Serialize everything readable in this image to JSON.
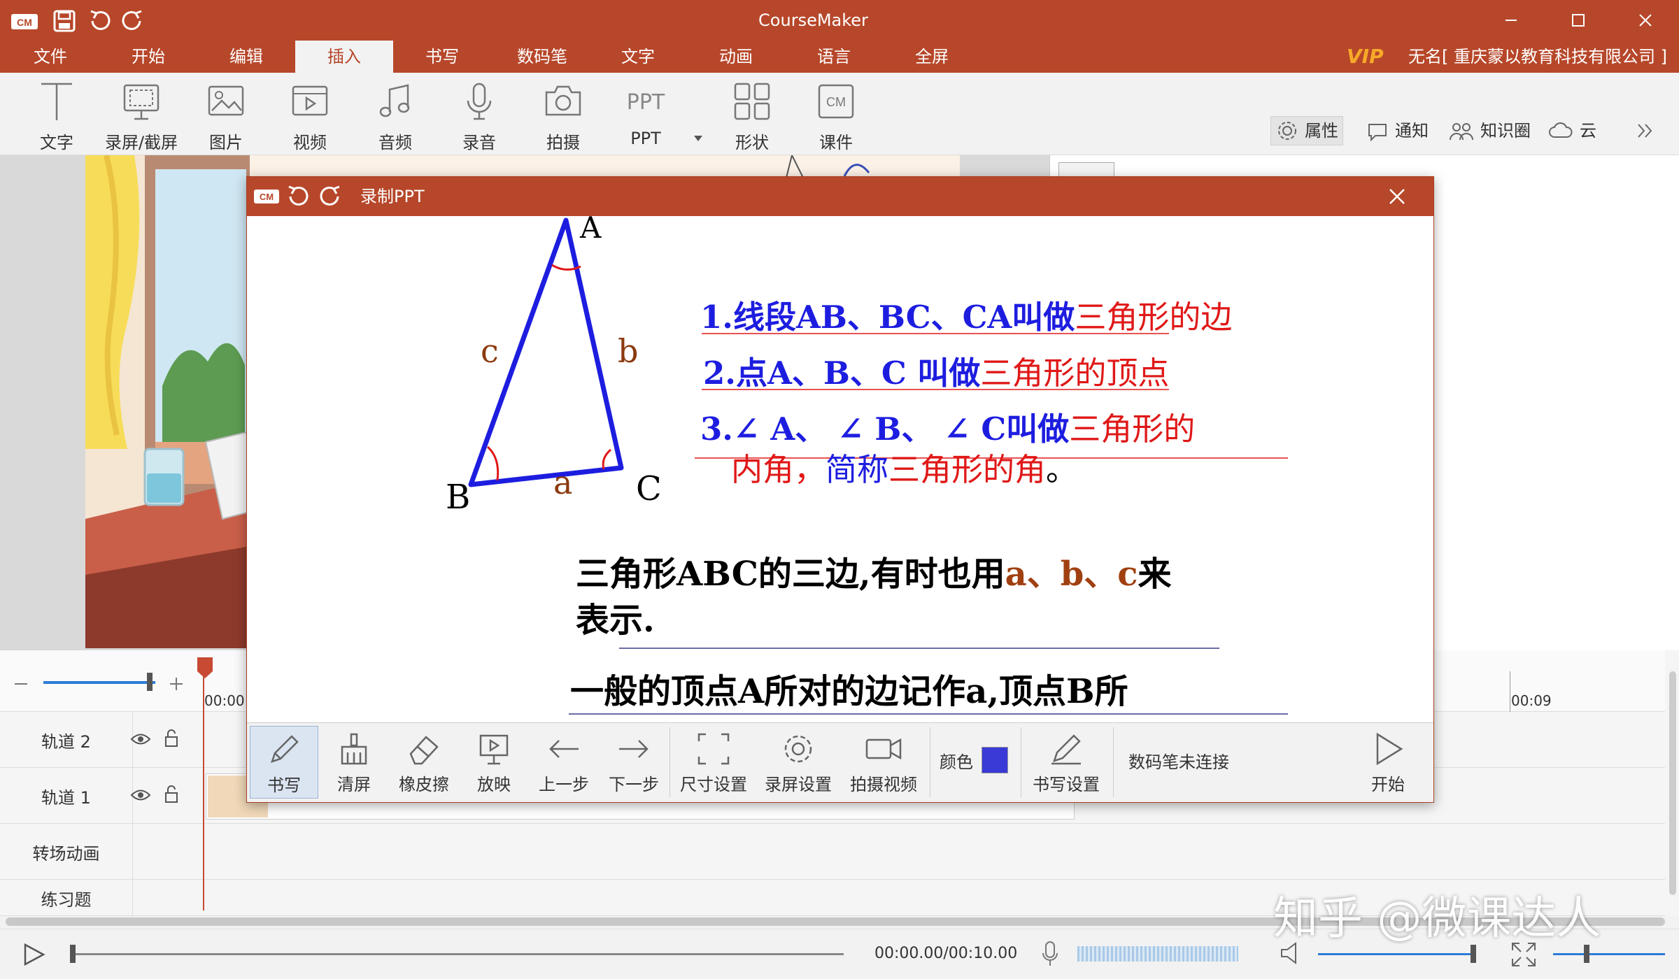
{
  "app": {
    "title": "CourseMaker",
    "logo": "CM",
    "brand_color": "#b7472a"
  },
  "menu": {
    "items": [
      "文件",
      "开始",
      "编辑",
      "插入",
      "书写",
      "数码笔",
      "文字",
      "动画",
      "语言",
      "全屏"
    ],
    "active": "插入",
    "vip": "VIP",
    "user": "无名[ 重庆蒙以教育科技有限公司 ]"
  },
  "ribbon": {
    "tools": [
      {
        "label": "文字",
        "icon": "text-icon"
      },
      {
        "label": "录屏/截屏",
        "icon": "screen-record-icon"
      },
      {
        "label": "图片",
        "icon": "image-icon"
      },
      {
        "label": "视频",
        "icon": "video-icon"
      },
      {
        "label": "音频",
        "icon": "music-icon"
      },
      {
        "label": "录音",
        "icon": "microphone-icon"
      },
      {
        "label": "拍摄",
        "icon": "camera-icon"
      },
      {
        "label": "PPT",
        "icon": "ppt-icon"
      },
      {
        "label": "形状",
        "icon": "shapes-icon"
      },
      {
        "label": "课件",
        "icon": "courseware-icon"
      }
    ],
    "right": [
      {
        "label": "属性",
        "icon": "gear-icon"
      },
      {
        "label": "通知",
        "icon": "chat-icon"
      },
      {
        "label": "知识圈",
        "icon": "people-icon"
      },
      {
        "label": "云",
        "icon": "cloud-icon"
      }
    ]
  },
  "timeline": {
    "tracks": [
      "轨道 2",
      "轨道 1",
      "转场动画",
      "练习题"
    ],
    "time_start": "00:00",
    "time_mark": "00:09"
  },
  "player": {
    "time": "00:00.00/00:10.00"
  },
  "dialog": {
    "title": "录制PPT",
    "logo": "CM",
    "slide": {
      "vertex_a": "A",
      "vertex_b": "B",
      "vertex_c": "C",
      "side_a": "a",
      "side_b": "b",
      "side_c": "c",
      "line1_blue": "1.线段AB、BC、CA叫做",
      "line1_red": "三角形的边",
      "line2_blue": "2.点A、B、C 叫做",
      "line2_red": "三角形的顶点",
      "line3_blue": "3.∠ A、 ∠ B、 ∠ C叫做",
      "line3_red": "三角形的",
      "line4_red": "内角，",
      "line4_blue": "简称",
      "line4_red2": "三角形的角",
      "line4_end": "。",
      "para1_a": "三角形ABC的三边,有时也用",
      "para1_b": "a、b、c",
      "para1_c": "来",
      "para1_d": "表示.",
      "para2": "一般的顶点A所对的边记作a,顶点B所"
    },
    "toolbar": {
      "tools": [
        {
          "label": "书写",
          "icon": "pen-icon"
        },
        {
          "label": "清屏",
          "icon": "broom-icon"
        },
        {
          "label": "橡皮擦",
          "icon": "eraser-icon"
        },
        {
          "label": "放映",
          "icon": "presentation-icon"
        },
        {
          "label": "上一步",
          "icon": "arrow-left-icon"
        },
        {
          "label": "下一步",
          "icon": "arrow-right-icon"
        },
        {
          "label": "尺寸设置",
          "icon": "size-frame-icon"
        },
        {
          "label": "录屏设置",
          "icon": "gear-icon"
        },
        {
          "label": "拍摄视频",
          "icon": "video-camera-icon"
        }
      ],
      "color_label": "颜色",
      "pen_color": "#3a3ad6",
      "pen_setting": "书写设置",
      "pen_status": "数码笔未连接",
      "start": "开始"
    }
  },
  "watermark": "知乎 @微课达人"
}
